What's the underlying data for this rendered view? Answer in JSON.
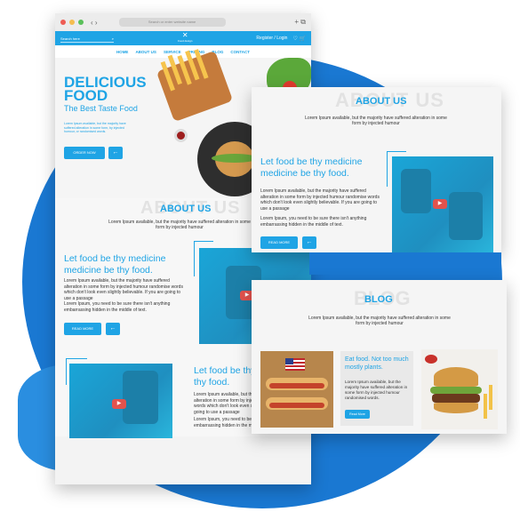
{
  "browser": {
    "address": "Search or enter website name",
    "controls": "‹ ›",
    "right_icons": "+ ⧉"
  },
  "topbar": {
    "search_placeholder": "Search here",
    "logo_name": "Food design",
    "register_login": "Register / Login"
  },
  "nav": [
    "HOME",
    "ABOUT US",
    "SERVICE",
    "PRICING",
    "BLOG",
    "CONTACT"
  ],
  "hero": {
    "title_line1": "DELICIOUS",
    "title_line2": "FOOD",
    "subtitle": "The Best Taste Food",
    "body": "Lorem Ipsum available, but the majority have suffered alteration in some form, by injected humour, or randomised words.",
    "button": "ORDER NOW",
    "arrow": "←"
  },
  "about": {
    "watermark": "ABOUT US",
    "title": "ABOUT US",
    "subtitle": "Lorem Ipsum available, but the majority have suffered alteration in some form by injected humour",
    "headline": "Let food be thy medicine medicine be thy food.",
    "body1": "Lorem Ipsum available, but the majority have suffered alteration in some form by injected humour randomise words which don't look even slightly believable. If you are going to use a passage",
    "body2": "Lorem Ipsum, you need to be sure there isn't anything embarrassing hidden in the middle of text.",
    "button": "READ MORE",
    "arrow": "←",
    "play": "▶"
  },
  "third": {
    "headline": "Let food be thy medicine be thy food.",
    "body1": "Lorem Ipsum available, but the majority have suffered alteration in some form by injected humour randomise words which don't look even slightly believable. If you are going to use a passage",
    "body2": "Lorem Ipsum, you need to be sure there isn't anything embarrassing hidden in the middle of text."
  },
  "blog": {
    "watermark": "BLOG",
    "title": "BLOG",
    "subtitle": "Lorem Ipsum available, but the majority have suffered alteration in some form by injected humour",
    "card_title": "Eat food. Not too much mostly plants.",
    "card_body": "Lorem Ipsum available, but the majority have suffered alteration in some form by injected humour randomised words.",
    "card_button": "Read More"
  },
  "colors": {
    "accent": "#1fa4e5",
    "backdrop": "#1a78d2"
  }
}
